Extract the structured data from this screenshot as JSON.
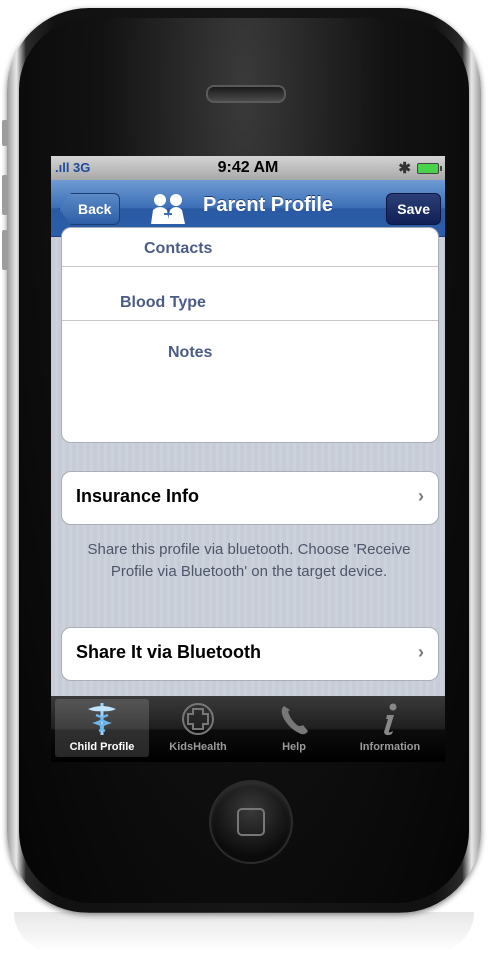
{
  "status_bar": {
    "signal": ".ıll 3G",
    "time": "9:42 AM",
    "bluetooth_icon": "bluetooth-icon",
    "battery_icon": "battery-icon"
  },
  "nav": {
    "back_label": "Back",
    "title": "Parent Profile",
    "save_label": "Save",
    "logo_icon": "parents-logo-icon"
  },
  "profile_fields": [
    {
      "label": "Contacts"
    },
    {
      "label": "Blood Type"
    },
    {
      "label": "Notes"
    }
  ],
  "insurance": {
    "label": "Insurance Info"
  },
  "bluetooth": {
    "note": "Share this profile via bluetooth. Choose 'Receive Profile via Bluetooth' on the target device.",
    "share_label": "Share It via Bluetooth"
  },
  "tabs": [
    {
      "label": "Child Profile",
      "icon": "caduceus-icon",
      "active": true
    },
    {
      "label": "KidsHealth",
      "icon": "medical-cross-icon",
      "active": false
    },
    {
      "label": "Help",
      "icon": "phone-handset-icon",
      "active": false
    },
    {
      "label": "Information",
      "icon": "info-icon",
      "active": false
    }
  ],
  "colors": {
    "nav_blue": "#2c5da8",
    "cell_label": "#4b5c86",
    "battery_green": "#4ad24a"
  }
}
